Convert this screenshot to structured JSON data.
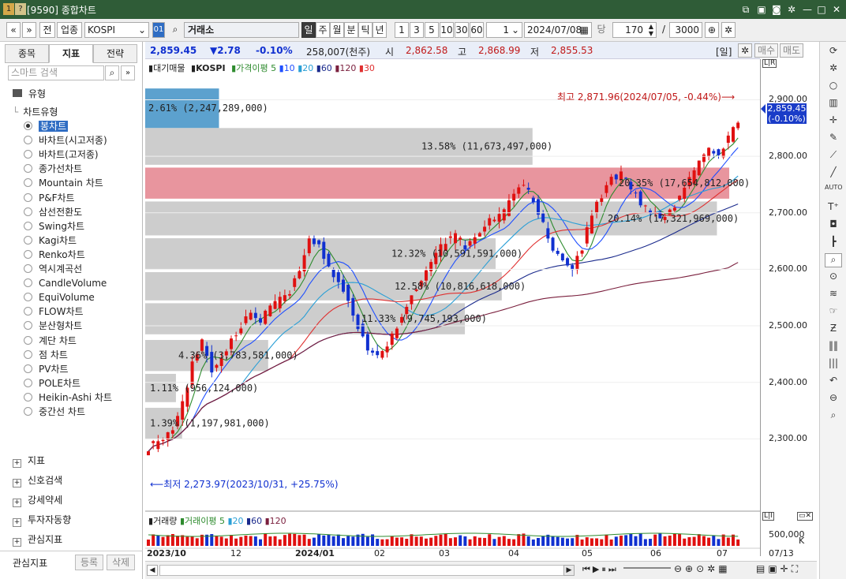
{
  "window": {
    "badge1": "1",
    "badge2": "?",
    "title": "[9590] 종합차트"
  },
  "toolbar": {
    "nav_prev": "«",
    "nav_down": "»",
    "btn_jeon": "전",
    "btn_upjong": "업종",
    "symbol": "KOSPI",
    "code": "01",
    "exchange": "거래소",
    "periods": [
      "일",
      "주",
      "월",
      "분",
      "틱",
      "년"
    ],
    "period_selected": "일",
    "intervals": [
      "1",
      "3",
      "5",
      "10",
      "30",
      "60"
    ],
    "interval_value": "1",
    "date": "2024/07/08",
    "dang": "당",
    "count": "170",
    "slash": "/",
    "max": "3000"
  },
  "left_panel": {
    "tabs": [
      "종목",
      "지표",
      "전략"
    ],
    "tab_selected": "지표",
    "search_placeholder": "스마트 검색",
    "category": "유형",
    "subcategory": "차트유형",
    "chart_types": [
      "봉차트",
      "바차트(시고저종)",
      "바차트(고저종)",
      "종가선차트",
      "Mountain 차트",
      "P&F차트",
      "삼선전환도",
      "Swing차트",
      "Kagi차트",
      "Renko차트",
      "역시계곡선",
      "CandleVolume",
      "EquiVolume",
      "FLOW차트",
      "분산형차트",
      "계단 차트",
      "점 차트",
      "PV차트",
      "POLE차트",
      "Heikin-Ashi 차트",
      "중간선 차트"
    ],
    "selected_type": "봉차트",
    "groups": [
      "지표",
      "신호검색",
      "강세약세",
      "투자자동향",
      "관심지표"
    ],
    "footer_label": "관심지표",
    "register": "등록",
    "delete": "삭제"
  },
  "info": {
    "price": "2,859.45",
    "change": "▼2.78",
    "pct": "-0.10%",
    "volume": "258,007(천주)",
    "open_label": "시",
    "open": "2,862.58",
    "high_label": "고",
    "high": "2,868.99",
    "low_label": "저",
    "low": "2,855.53",
    "period": "[일]",
    "buy": "매수",
    "sell": "매도"
  },
  "legend": {
    "main": "대기매물",
    "symbol": "KOSPI",
    "ma_label": "가격이평",
    "ma": [
      "5",
      "10",
      "20",
      "60",
      "120",
      "30"
    ],
    "vol": "거래량",
    "vol_ma_label": "거래이평",
    "vol_ma": [
      "5",
      "20",
      "60",
      "120"
    ]
  },
  "colors": {
    "ma5": "#2e8b2e",
    "ma10": "#1f4fff",
    "ma20": "#2a9fd6",
    "ma60": "#1a2a8c",
    "ma120": "#7a1f3d",
    "ma30": "#e03030",
    "up": "#e01010",
    "down": "#1030d0",
    "band": "#c8c8c8",
    "band_hl": "#e68a94",
    "band_top": "#4a97c9"
  },
  "annotations": {
    "high": "최고 2,871.96(2024/07/05, -0.44%)",
    "low": "최저 2,273.97(2023/10/31, +25.75%)",
    "last_price": "2,859.45",
    "last_pct": "(-0.10%)"
  },
  "chart_data": {
    "type": "candlestick",
    "symbol": "KOSPI",
    "ylim": [
      2260,
      2930
    ],
    "yticks": [
      "2,900.00",
      "2,800.00",
      "2,700.00",
      "2,600.00",
      "2,500.00",
      "2,400.00",
      "2,300.00"
    ],
    "xticks": [
      "2023/10",
      "12",
      "2024/01",
      "02",
      "03",
      "04",
      "05",
      "06",
      "07"
    ],
    "date_end": "07/13",
    "volume_ytick": "500,000",
    "volume_unit": "K",
    "close_path": [
      2290,
      2300,
      2320,
      2360,
      2430,
      2470,
      2420,
      2440,
      2480,
      2500,
      2520,
      2510,
      2530,
      2550,
      2560,
      2600,
      2660,
      2640,
      2600,
      2580,
      2550,
      2500,
      2460,
      2450,
      2470,
      2500,
      2540,
      2570,
      2600,
      2630,
      2650,
      2660,
      2640,
      2660,
      2680,
      2690,
      2700,
      2740,
      2750,
      2720,
      2680,
      2640,
      2620,
      2600,
      2640,
      2700,
      2730,
      2760,
      2770,
      2740,
      2720,
      2700,
      2690,
      2700,
      2730,
      2760,
      2790,
      2810,
      2800,
      2830,
      2860
    ],
    "volume_profile": [
      {
        "pct": "2.61%",
        "vol": "2,247,289,000"
      },
      {
        "pct": "13.58%",
        "vol": "11,673,497,000"
      },
      {
        "pct": "20.35%",
        "vol": "17,654,812,000"
      },
      {
        "pct": "20.14%",
        "vol": "17,321,969,000"
      },
      {
        "pct": "12.32%",
        "vol": "10,591,591,000"
      },
      {
        "pct": "12.58%",
        "vol": "10,816,618,000"
      },
      {
        "pct": "11.33%",
        "vol": "9,745,193,000"
      },
      {
        "pct": "4.36%",
        "vol": "3,783,581,000"
      },
      {
        "pct": "1.11%",
        "vol": "956,124,000"
      },
      {
        "pct": "1.39%",
        "vol": "1,197,981,000"
      }
    ]
  }
}
